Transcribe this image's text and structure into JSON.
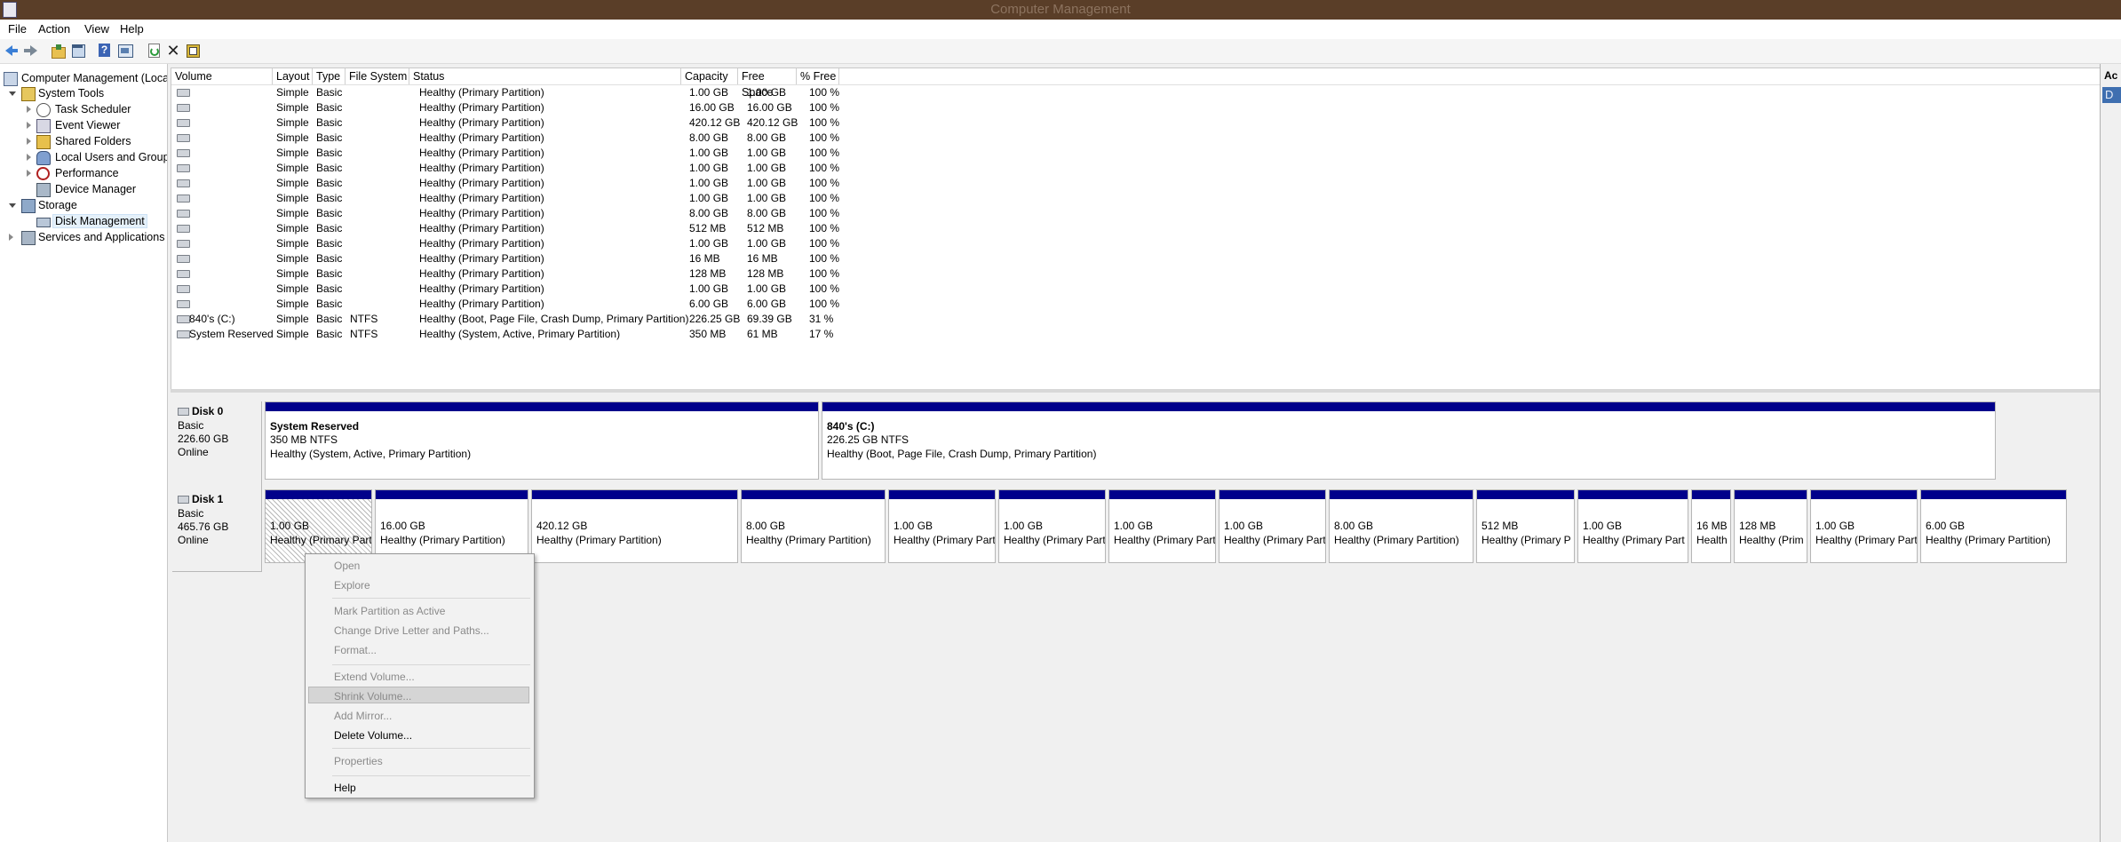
{
  "window": {
    "title": "Computer Management"
  },
  "menu": [
    "File",
    "Action",
    "View",
    "Help"
  ],
  "toolbar": [
    "back-icon",
    "forward-icon",
    "up-folder-icon",
    "console-tree-icon",
    "help-icon",
    "view-icon",
    "refresh-icon",
    "delete-icon",
    "properties-icon"
  ],
  "tree": [
    {
      "label": "Computer Management (Local",
      "level": 0,
      "expander": "none",
      "icon": "computer-icon"
    },
    {
      "label": "System Tools",
      "level": 1,
      "expander": "open",
      "icon": "system-tools-icon"
    },
    {
      "label": "Task Scheduler",
      "level": 2,
      "expander": "closed",
      "icon": "clock-icon"
    },
    {
      "label": "Event Viewer",
      "level": 2,
      "expander": "closed",
      "icon": "event-viewer-icon"
    },
    {
      "label": "Shared Folders",
      "level": 2,
      "expander": "closed",
      "icon": "shared-folder-icon"
    },
    {
      "label": "Local Users and Groups",
      "level": 2,
      "expander": "closed",
      "icon": "users-icon"
    },
    {
      "label": "Performance",
      "level": 2,
      "expander": "closed",
      "icon": "performance-icon"
    },
    {
      "label": "Device Manager",
      "level": 2,
      "expander": "none",
      "icon": "device-manager-icon"
    },
    {
      "label": "Storage",
      "level": 1,
      "expander": "open",
      "icon": "storage-icon"
    },
    {
      "label": "Disk Management",
      "level": 2,
      "expander": "none",
      "icon": "disk-icon",
      "selected": true
    },
    {
      "label": "Services and Applications",
      "level": 1,
      "expander": "closed",
      "icon": "services-icon"
    }
  ],
  "volumes": {
    "columns": [
      "Volume",
      "Layout",
      "Type",
      "File System",
      "Status",
      "Capacity",
      "Free Space",
      "% Free"
    ],
    "rows": [
      [
        "",
        "Simple",
        "Basic",
        "",
        "Healthy (Primary Partition)",
        "1.00 GB",
        "1.00 GB",
        "100 %"
      ],
      [
        "",
        "Simple",
        "Basic",
        "",
        "Healthy (Primary Partition)",
        "16.00 GB",
        "16.00 GB",
        "100 %"
      ],
      [
        "",
        "Simple",
        "Basic",
        "",
        "Healthy (Primary Partition)",
        "420.12 GB",
        "420.12 GB",
        "100 %"
      ],
      [
        "",
        "Simple",
        "Basic",
        "",
        "Healthy (Primary Partition)",
        "8.00 GB",
        "8.00 GB",
        "100 %"
      ],
      [
        "",
        "Simple",
        "Basic",
        "",
        "Healthy (Primary Partition)",
        "1.00 GB",
        "1.00 GB",
        "100 %"
      ],
      [
        "",
        "Simple",
        "Basic",
        "",
        "Healthy (Primary Partition)",
        "1.00 GB",
        "1.00 GB",
        "100 %"
      ],
      [
        "",
        "Simple",
        "Basic",
        "",
        "Healthy (Primary Partition)",
        "1.00 GB",
        "1.00 GB",
        "100 %"
      ],
      [
        "",
        "Simple",
        "Basic",
        "",
        "Healthy (Primary Partition)",
        "1.00 GB",
        "1.00 GB",
        "100 %"
      ],
      [
        "",
        "Simple",
        "Basic",
        "",
        "Healthy (Primary Partition)",
        "8.00 GB",
        "8.00 GB",
        "100 %"
      ],
      [
        "",
        "Simple",
        "Basic",
        "",
        "Healthy (Primary Partition)",
        "512 MB",
        "512 MB",
        "100 %"
      ],
      [
        "",
        "Simple",
        "Basic",
        "",
        "Healthy (Primary Partition)",
        "1.00 GB",
        "1.00 GB",
        "100 %"
      ],
      [
        "",
        "Simple",
        "Basic",
        "",
        "Healthy (Primary Partition)",
        "16 MB",
        "16 MB",
        "100 %"
      ],
      [
        "",
        "Simple",
        "Basic",
        "",
        "Healthy (Primary Partition)",
        "128 MB",
        "128 MB",
        "100 %"
      ],
      [
        "",
        "Simple",
        "Basic",
        "",
        "Healthy (Primary Partition)",
        "1.00 GB",
        "1.00 GB",
        "100 %"
      ],
      [
        "",
        "Simple",
        "Basic",
        "",
        "Healthy (Primary Partition)",
        "6.00 GB",
        "6.00 GB",
        "100 %"
      ],
      [
        "840's (C:)",
        "Simple",
        "Basic",
        "NTFS",
        "Healthy (Boot, Page File, Crash Dump, Primary Partition)",
        "226.25 GB",
        "69.39 GB",
        "31 %"
      ],
      [
        "System Reserved",
        "Simple",
        "Basic",
        "NTFS",
        "Healthy (System, Active, Primary Partition)",
        "350 MB",
        "61 MB",
        "17 %"
      ]
    ]
  },
  "disks": [
    {
      "name": "Disk 0",
      "type": "Basic",
      "size": "226.60 GB",
      "status": "Online",
      "partitions": [
        {
          "title": "System Reserved",
          "size": "350 MB NTFS",
          "status": "Healthy (System, Active, Primary Partition)"
        },
        {
          "title": "840's  (C:)",
          "size": "226.25 GB NTFS",
          "status": "Healthy (Boot, Page File, Crash Dump, Primary Partition)"
        }
      ]
    },
    {
      "name": "Disk 1",
      "type": "Basic",
      "size": "465.76 GB",
      "status": "Online",
      "partitions": [
        {
          "size": "1.00 GB",
          "status": "Healthy (Primary Parti",
          "selected": true
        },
        {
          "size": "16.00 GB",
          "status": "Healthy (Primary Partition)"
        },
        {
          "size": "420.12 GB",
          "status": "Healthy (Primary Partition)"
        },
        {
          "size": "8.00 GB",
          "status": "Healthy (Primary Partition)"
        },
        {
          "size": "1.00 GB",
          "status": "Healthy (Primary Part"
        },
        {
          "size": "1.00 GB",
          "status": "Healthy (Primary Part"
        },
        {
          "size": "1.00 GB",
          "status": "Healthy (Primary Part"
        },
        {
          "size": "1.00 GB",
          "status": "Healthy (Primary Part"
        },
        {
          "size": "8.00 GB",
          "status": "Healthy (Primary Partition)"
        },
        {
          "size": "512 MB",
          "status": "Healthy (Primary P"
        },
        {
          "size": "1.00 GB",
          "status": "Healthy (Primary Part"
        },
        {
          "size": "16 MB",
          "status": "Health"
        },
        {
          "size": "128 MB",
          "status": "Healthy (Prim"
        },
        {
          "size": "1.00 GB",
          "status": "Healthy (Primary Part"
        },
        {
          "size": "6.00 GB",
          "status": "Healthy (Primary Partition)"
        }
      ]
    }
  ],
  "context_menu": {
    "items": [
      {
        "label": "Open",
        "enabled": false
      },
      {
        "label": "Explore",
        "enabled": false
      },
      {
        "sep": true
      },
      {
        "label": "Mark Partition as Active",
        "enabled": false
      },
      {
        "label": "Change Drive Letter and Paths...",
        "enabled": false
      },
      {
        "label": "Format...",
        "enabled": false
      },
      {
        "sep": true
      },
      {
        "label": "Extend Volume...",
        "enabled": false
      },
      {
        "label": "Shrink Volume...",
        "enabled": false,
        "highlighted": true
      },
      {
        "label": "Add Mirror...",
        "enabled": false
      },
      {
        "label": "Delete Volume...",
        "enabled": true
      },
      {
        "sep": true
      },
      {
        "label": "Properties",
        "enabled": false
      },
      {
        "sep": true
      },
      {
        "label": "Help",
        "enabled": true
      }
    ]
  },
  "actions_pane": {
    "header": "Ac",
    "item": "D"
  }
}
